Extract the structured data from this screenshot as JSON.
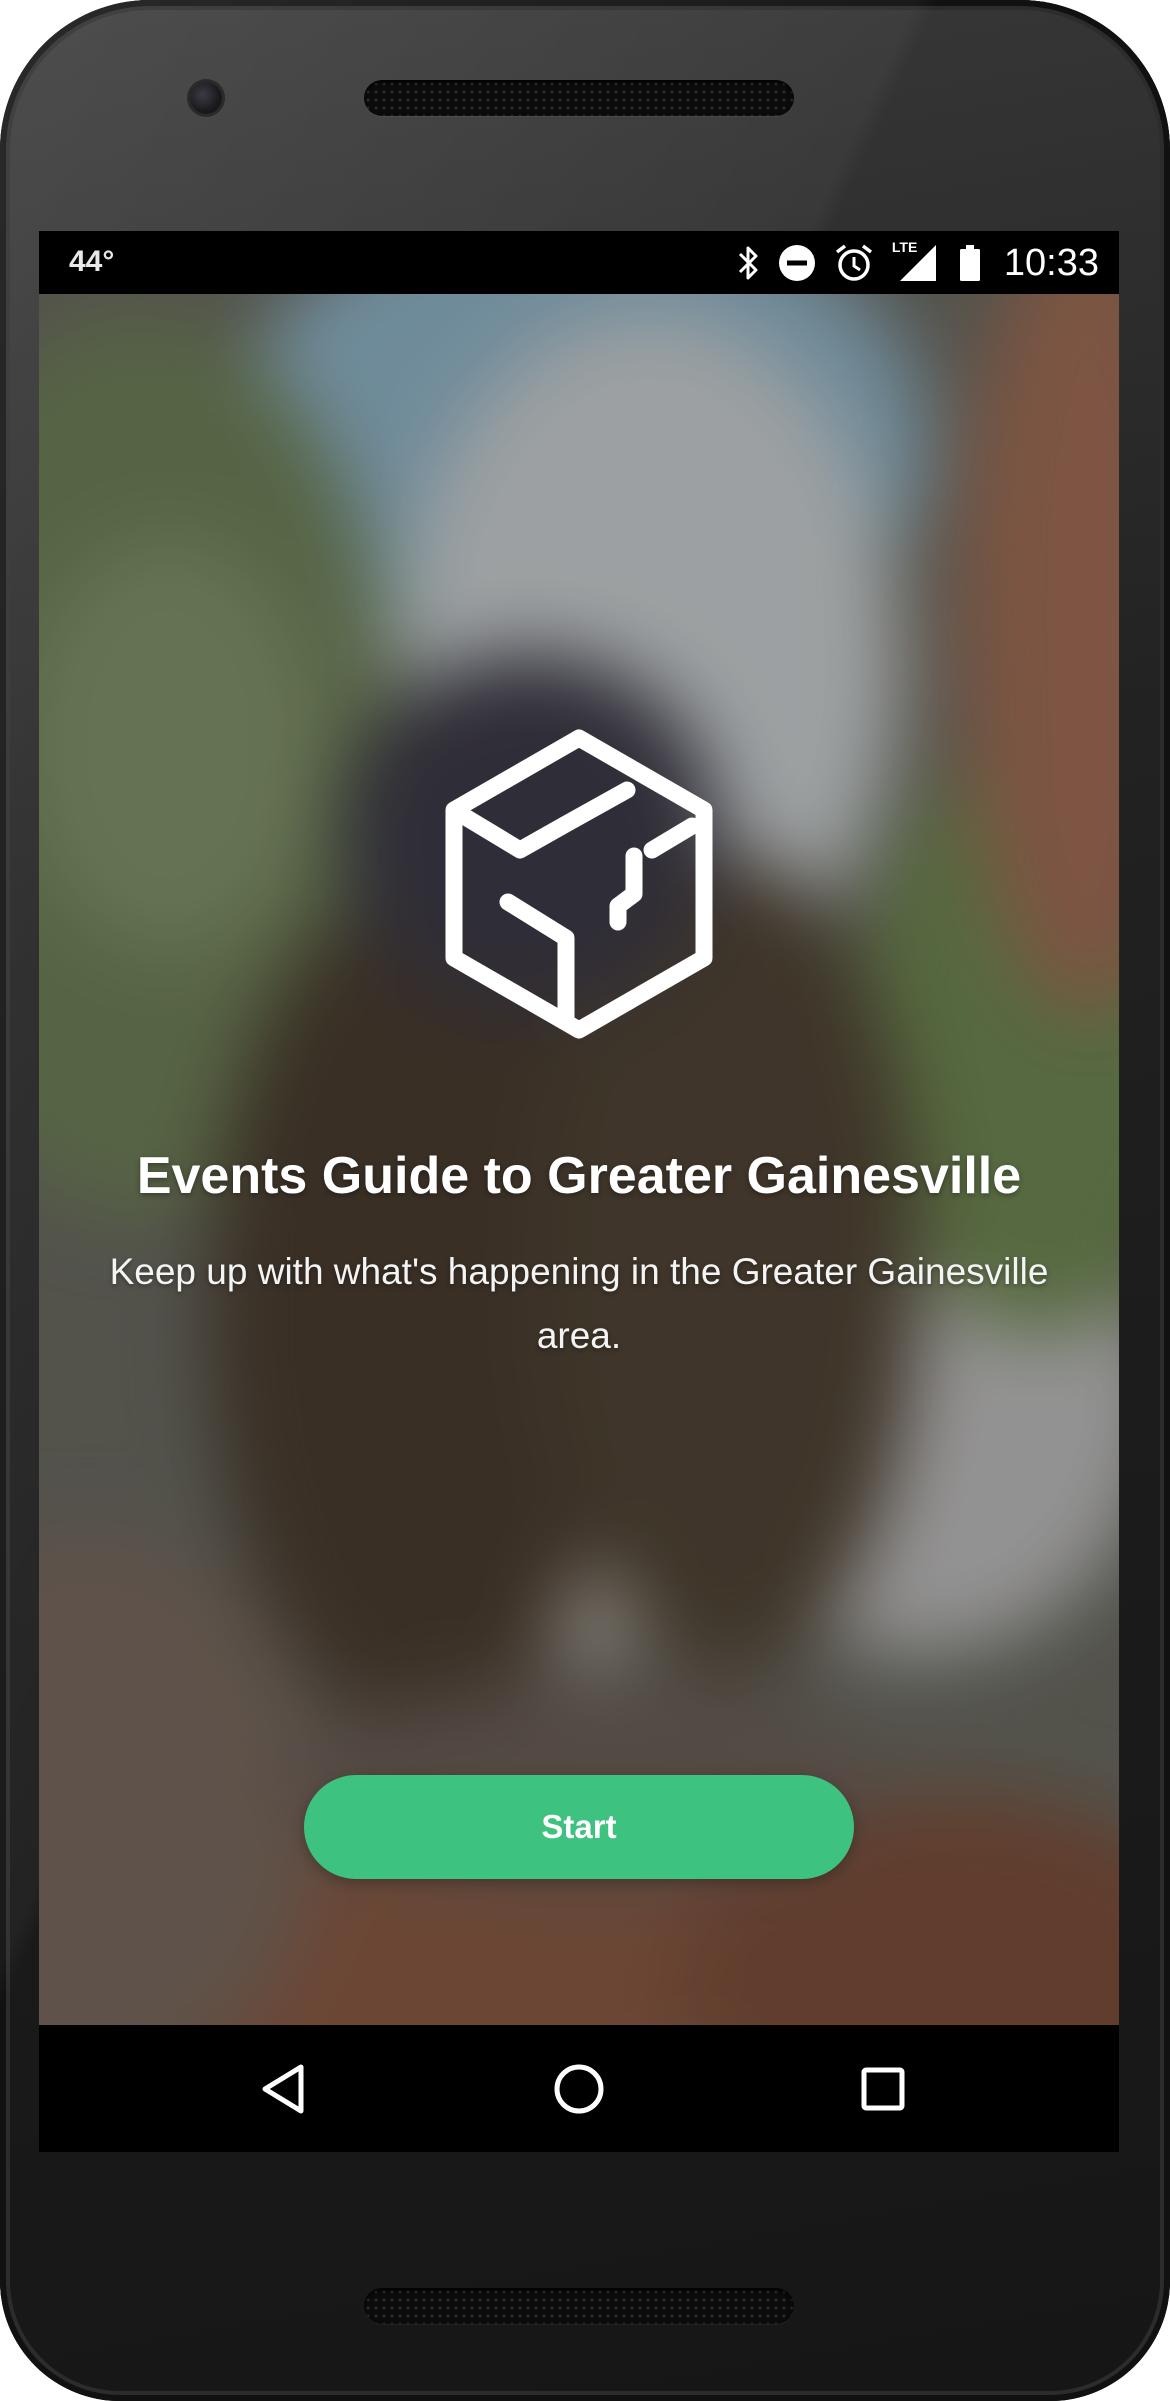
{
  "status_bar": {
    "temperature": "44°",
    "icons": [
      "bluetooth-icon",
      "do-not-disturb-icon",
      "alarm-icon",
      "lte-signal-icon",
      "battery-icon"
    ],
    "lte_label": "LTE",
    "time": "10:33"
  },
  "onboarding": {
    "logo_icon": "cube-logo-icon",
    "title": "Events Guide to Greater Gainesville",
    "description": "Keep up with what's happening in the Greater Gainesville area.",
    "start_label": "Start"
  },
  "nav_bar": {
    "buttons": [
      "back-icon",
      "home-icon",
      "recents-icon"
    ]
  },
  "colors": {
    "accent": "#3ec27f",
    "status_bar": "#000000",
    "nav_bar": "#000000",
    "text": "#ffffff"
  }
}
